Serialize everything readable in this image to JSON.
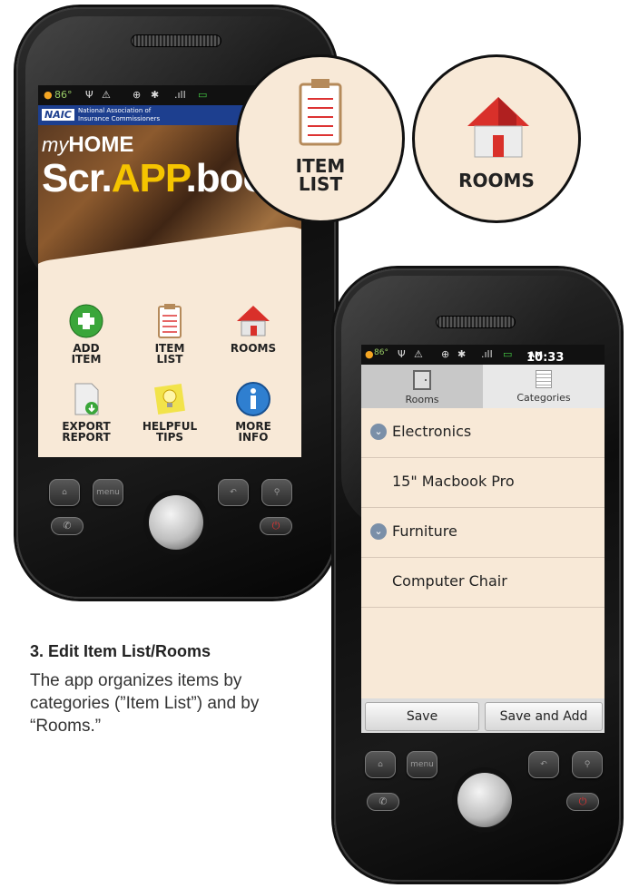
{
  "phone1": {
    "status_time": "86°",
    "banner": {
      "logo": "NAIC",
      "line1": "National Association of",
      "line2": "Insurance Commissioners"
    },
    "hero": {
      "my": "my",
      "home": "HOME",
      "scr": "Scr.",
      "app": "APP",
      "book": ".book"
    },
    "tiles": [
      {
        "label1": "ADD",
        "label2": "ITEM"
      },
      {
        "label1": "ITEM",
        "label2": "LIST"
      },
      {
        "label1": "ROOMS",
        "label2": ""
      },
      {
        "label1": "EXPORT",
        "label2": "REPORT"
      },
      {
        "label1": "HELPFUL",
        "label2": "TIPS"
      },
      {
        "label1": "MORE",
        "label2": "INFO"
      }
    ],
    "hw": {
      "menu": "menu"
    }
  },
  "bubbles": {
    "item_list": {
      "line1": "ITEM",
      "line2": "LIST"
    },
    "rooms": {
      "label": "ROOMS"
    }
  },
  "phone2": {
    "status_time": "10:33",
    "status_ampm": "AM",
    "status_temp": "86°",
    "tabs": [
      {
        "label": "Rooms"
      },
      {
        "label": "Categories"
      }
    ],
    "rows": [
      {
        "text": "Electronics",
        "expandable": true
      },
      {
        "text": "15\" Macbook Pro",
        "expandable": false
      },
      {
        "text": "Furniture",
        "expandable": true
      },
      {
        "text": "Computer Chair",
        "expandable": false
      }
    ],
    "buttons": {
      "save": "Save",
      "save_add": "Save and Add"
    },
    "hw": {
      "menu": "menu"
    }
  },
  "caption": {
    "title": "3. Edit Item List/Rooms",
    "body": "The app organizes items by categories (”Item List”) and by “Rooms.”"
  },
  "colors": {
    "screen_bg": "#f8e9d7",
    "accent_blue": "#1d3f8f",
    "green": "#3aa63a",
    "red_roof": "#d9302a"
  }
}
